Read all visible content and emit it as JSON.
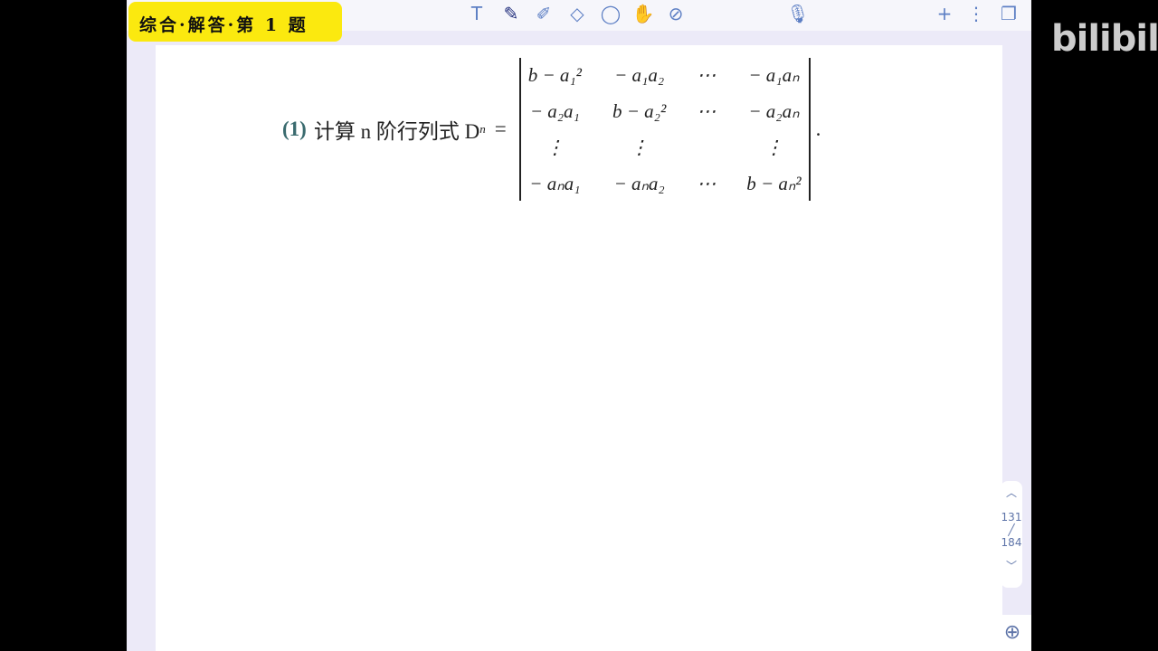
{
  "title": "综合·解答·第 1 题",
  "toolbar": {
    "icons": [
      "text-icon",
      "pen-icon",
      "highlighter-icon",
      "eraser-icon",
      "lasso-icon",
      "hand-icon",
      "laser-icon",
      "mic-icon",
      "add-icon",
      "more-icon",
      "pages-icon"
    ]
  },
  "problem": {
    "label": "(1)",
    "text": "计算 n 阶行列式 D",
    "sub": "n",
    "eq": "=",
    "matrix": [
      [
        "b − a₁²",
        "− a₁a₂",
        "⋯",
        "− a₁aₙ"
      ],
      [
        "− a₂a₁",
        "b − a₂²",
        "⋯",
        "− a₂aₙ"
      ],
      [
        "⋮",
        "⋮",
        "",
        "⋮"
      ],
      [
        "− aₙa₁",
        "− aₙa₂",
        "⋯",
        "b − aₙ²"
      ]
    ],
    "end": "."
  },
  "pager": {
    "current": "131",
    "total": "184"
  },
  "watermark": "bilibili"
}
